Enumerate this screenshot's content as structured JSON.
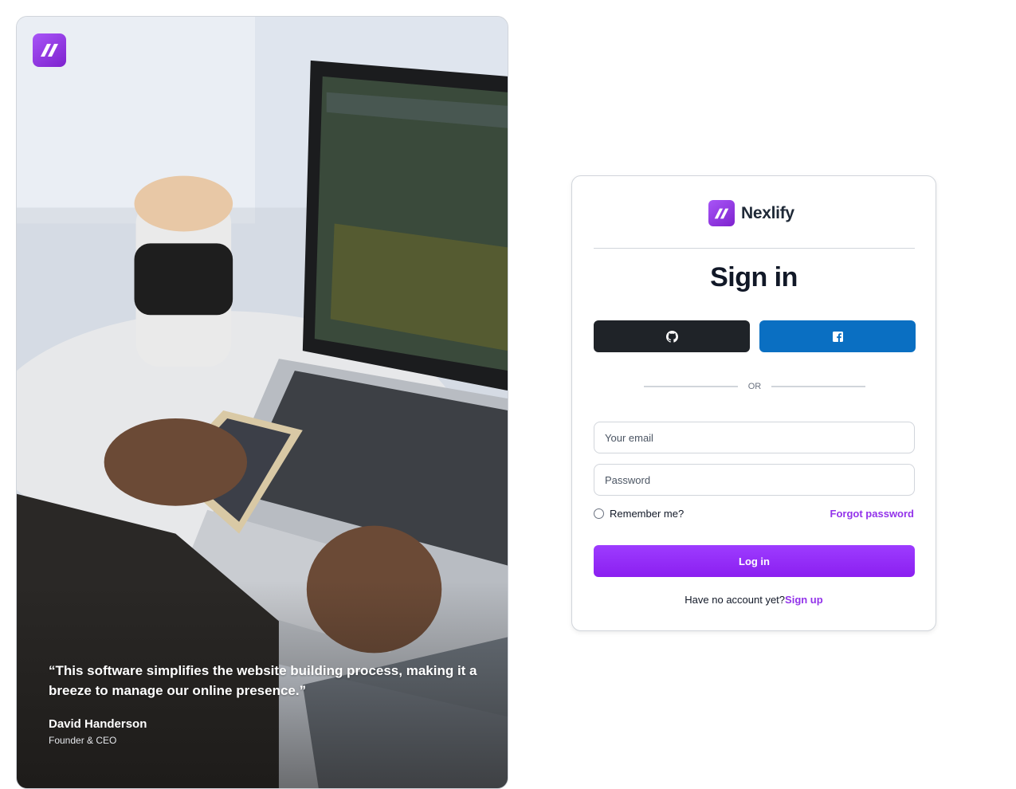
{
  "hero": {
    "quote": "“This software simplifies the website building process, making it a breeze to manage our online presence.”",
    "author_name": "David Handerson",
    "author_role": "Founder & CEO"
  },
  "brand": {
    "name": "Nexlify",
    "logo_icon": "nexlify-logo-icon",
    "accent": "#9333ea"
  },
  "signin": {
    "title": "Sign in",
    "github_icon": "github-icon",
    "facebook_icon": "facebook-icon",
    "divider_text": "OR",
    "email_placeholder": "Your email",
    "password_placeholder": "Password",
    "remember_label": "Remember me?",
    "forgot_label": "Forgot password",
    "login_label": "Log in",
    "no_account_text": "Have no account yet?",
    "signup_label": "Sign up"
  }
}
